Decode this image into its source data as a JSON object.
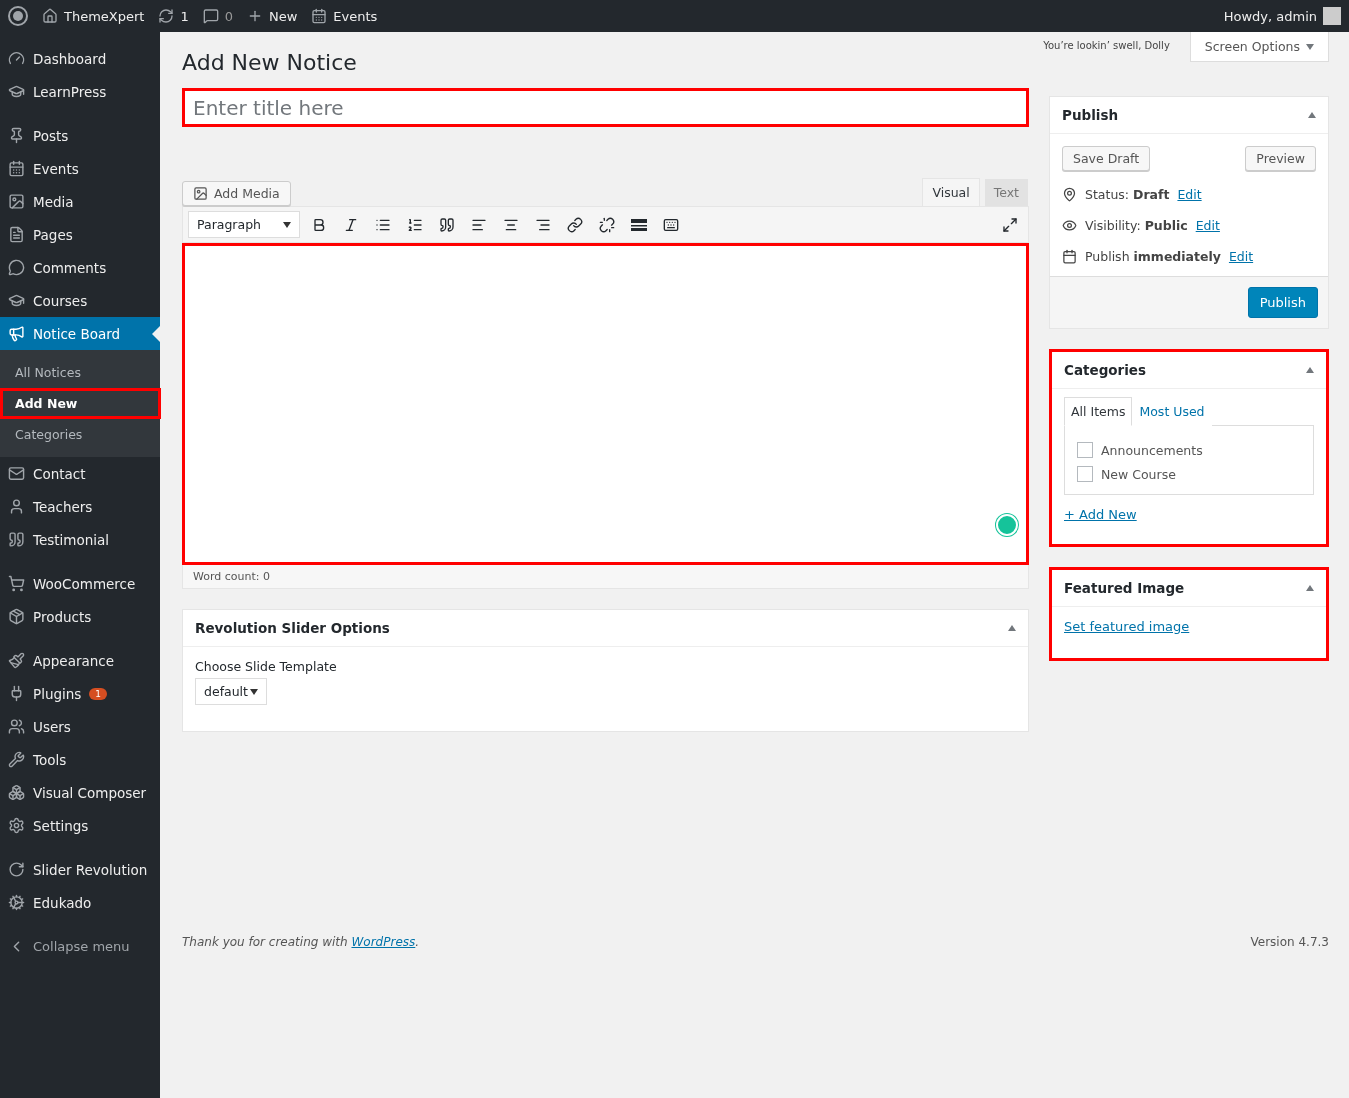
{
  "admin_bar": {
    "site": "ThemeXpert",
    "updates": "1",
    "comments": "0",
    "new": "New",
    "events": "Events",
    "greeting": "Howdy, admin"
  },
  "sidebar": {
    "groups": [
      [
        {
          "label": "Dashboard",
          "selected": false
        },
        {
          "label": "LearnPress",
          "selected": false
        }
      ],
      [
        {
          "label": "Posts",
          "selected": false
        },
        {
          "label": "Events",
          "selected": false
        },
        {
          "label": "Media",
          "selected": false
        },
        {
          "label": "Pages",
          "selected": false
        },
        {
          "label": "Comments",
          "selected": false
        },
        {
          "label": "Courses",
          "selected": false
        },
        {
          "label": "Notice Board",
          "selected": true,
          "children": [
            {
              "label": "All Notices",
              "selected": false,
              "highlighted": false
            },
            {
              "label": "Add New",
              "selected": true,
              "highlighted": true
            },
            {
              "label": "Categories",
              "selected": false,
              "highlighted": false
            }
          ]
        },
        {
          "label": "Contact",
          "selected": false
        },
        {
          "label": "Teachers",
          "selected": false
        },
        {
          "label": "Testimonial",
          "selected": false
        }
      ],
      [
        {
          "label": "WooCommerce",
          "selected": false
        },
        {
          "label": "Products",
          "selected": false
        }
      ],
      [
        {
          "label": "Appearance",
          "selected": false
        },
        {
          "label": "Plugins",
          "selected": false,
          "badge": "1"
        },
        {
          "label": "Users",
          "selected": false
        },
        {
          "label": "Tools",
          "selected": false
        },
        {
          "label": "Visual Composer",
          "selected": false
        },
        {
          "label": "Settings",
          "selected": false
        }
      ],
      [
        {
          "label": "Slider Revolution",
          "selected": false
        },
        {
          "label": "Edukado",
          "selected": false
        }
      ]
    ],
    "collapse": "Collapse menu"
  },
  "dolly": "You’re lookin’ swell, Dolly",
  "screen_options": "Screen Options",
  "page_title": "Add New Notice",
  "title_field": {
    "placeholder": "Enter title here",
    "highlighted": true
  },
  "editor": {
    "add_media": "Add Media",
    "tabs": [
      {
        "label": "Visual",
        "selected": true
      },
      {
        "label": "Text",
        "selected": false
      }
    ],
    "format": "Paragraph",
    "highlighted": true,
    "word_count": "Word count: 0"
  },
  "slider_box": {
    "title": "Revolution Slider Options",
    "label": "Choose Slide Template",
    "value": "default"
  },
  "publish_box": {
    "title": "Publish",
    "save_draft": "Save Draft",
    "preview": "Preview",
    "rows": [
      {
        "label": "Status:",
        "value": "Draft",
        "link": "Edit"
      },
      {
        "label": "Visibility:",
        "value": "Public",
        "link": "Edit"
      },
      {
        "label": "Publish",
        "value": "immediately",
        "link": "Edit"
      }
    ],
    "publish": "Publish"
  },
  "categories_box": {
    "title": "Categories",
    "highlighted": true,
    "tabs": [
      {
        "label": "All Items",
        "selected": true
      },
      {
        "label": "Most Used",
        "selected": false
      }
    ],
    "items": [
      {
        "label": "Announcements",
        "checked": false
      },
      {
        "label": "New Course",
        "checked": false
      }
    ],
    "add_new": "+ Add New"
  },
  "featured_box": {
    "title": "Featured Image",
    "highlighted": true,
    "link": "Set featured image"
  },
  "footer": {
    "thanks": "Thank you for creating with",
    "link": "WordPress",
    "after": ".",
    "version": "Version 4.7.3"
  }
}
